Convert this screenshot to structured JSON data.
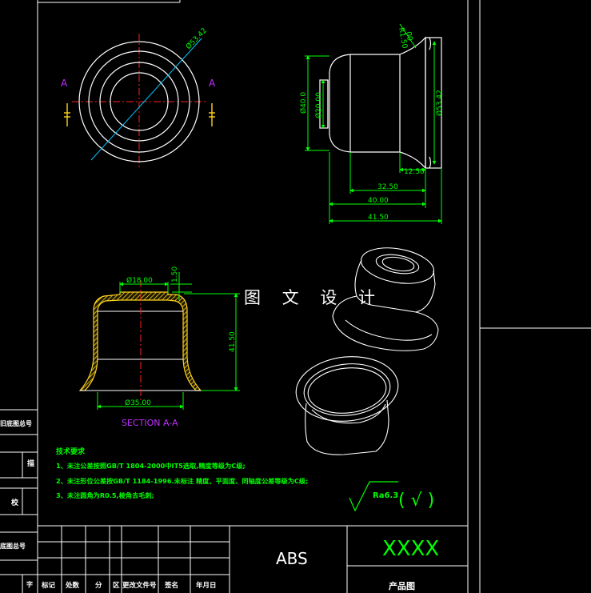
{
  "watermark": "图 文 设 计",
  "section_markers": [
    "A",
    "A"
  ],
  "top_view": {
    "dim_diameter": "Ø53.42"
  },
  "side_view": {
    "dim_radius": "R1.50",
    "dim_r_sub": "00",
    "dim_d40": "Ø40.0",
    "dim_d20": "Ø20.00",
    "dim_d53": "Ø53.42",
    "dim_12_50": "12.50",
    "dim_32_50": "32.50",
    "dim_40": "40.00",
    "dim_41_50": "41.50"
  },
  "section_view": {
    "dim_d18": "Ø18.00",
    "dim_1_50": "1.50",
    "dim_41_50": "41.50",
    "dim_d35": "Ø35.00",
    "title": "SECTION A-A"
  },
  "tech_notes": {
    "heading": "技术要求",
    "lines": [
      "1、未注公差按照GB/T 1804-2000中IT5选取,精度等级为C级;",
      "2、未注形位公差按GB/T 1184-1996.未标注 精度、平面度、同轴度公差等级为C级;",
      "3、未注圆角为R0.5,棱角去毛刺;"
    ]
  },
  "roughness": {
    "value": "Ra6.3",
    "paren": "( √ )"
  },
  "title_block": {
    "material": "ABS",
    "part_name": "XXXX",
    "drawing_type": "产品图",
    "headers": [
      "标记",
      "处数",
      "分",
      "区",
      "更改文件号",
      "签名",
      "年月日"
    ]
  },
  "left_strip": {
    "labels": [
      "旧底图总号",
      "描",
      "校",
      "底图总号",
      "字"
    ]
  },
  "colors": {
    "outline": "#ffffff",
    "dimension": "#00ff00",
    "centerline": "#ff2020",
    "section_cut": "#00c8ff",
    "hatch": "#ffd21e",
    "marker": "#c030ff"
  }
}
